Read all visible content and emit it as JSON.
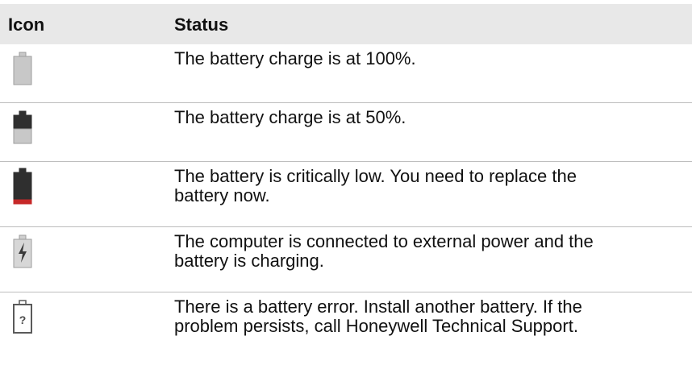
{
  "table": {
    "header": {
      "icon": "Icon",
      "status": "Status"
    },
    "rows": [
      {
        "icon_name": "battery-full-icon",
        "status": "The battery charge is at 100%.",
        "charge_percent": 100
      },
      {
        "icon_name": "battery-half-icon",
        "status": "The battery charge is at 50%.",
        "charge_percent": 50
      },
      {
        "icon_name": "battery-critical-icon",
        "status": "The battery is critically low. You need to replace the\nbattery now.",
        "indicator_color": "#d32f2f"
      },
      {
        "icon_name": "battery-charging-icon",
        "status": "The computer is connected to external power and the\nbattery is charging."
      },
      {
        "icon_name": "battery-error-icon",
        "status": "There is a battery error. Install another battery. If the\nproblem persists, call Honeywell Technical Support."
      }
    ]
  }
}
